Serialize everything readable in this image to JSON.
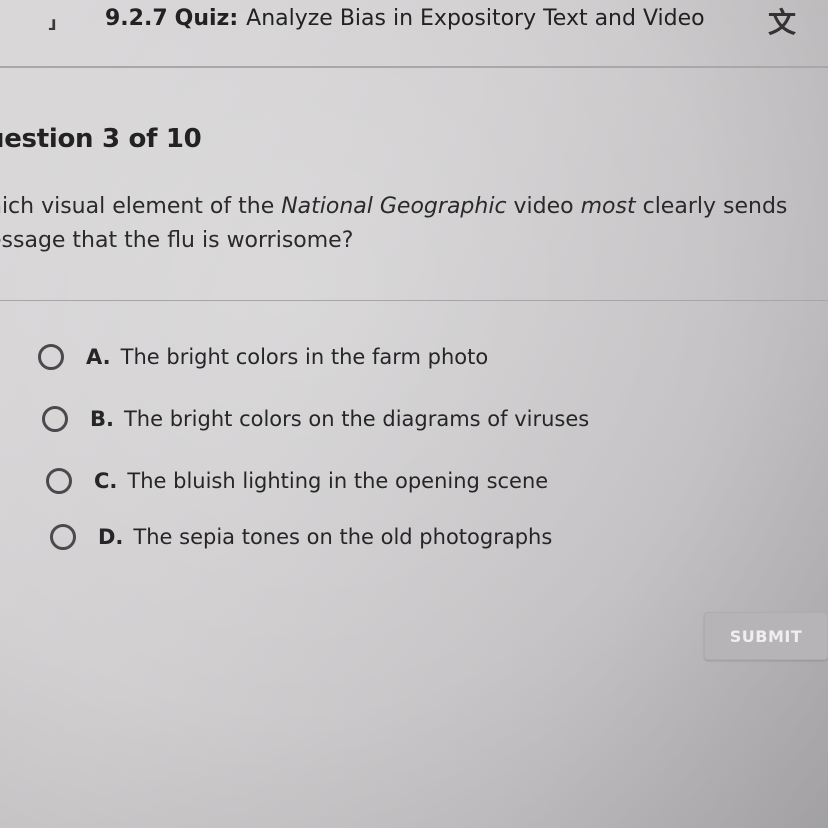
{
  "header": {
    "back_icon": "back-arrow-icon",
    "quiz_number": "9.2.7",
    "quiz_kind": "Quiz:",
    "quiz_title": "Analyze Bias in Expository Text and Video",
    "translate_icon": "translate-icon"
  },
  "question": {
    "header": "uestion 3 of 10",
    "text_part1": "hich visual element of the ",
    "text_italic1": "National Geographic",
    "text_part2": " video ",
    "text_italic2": "most",
    "text_part3": " clearly sends",
    "text_line2": "essage that the flu is worrisome?"
  },
  "answers": [
    {
      "letter": "A.",
      "text": "The bright colors in the farm photo"
    },
    {
      "letter": "B.",
      "text": "The bright colors on the diagrams of viruses"
    },
    {
      "letter": "C.",
      "text": "The bluish lighting in the opening scene"
    },
    {
      "letter": "D.",
      "text": "The sepia tones on the old photographs"
    }
  ],
  "submit_label": "SUBMIT",
  "colors": {
    "background": "#d1cfd0",
    "text": "#2a2a2c",
    "submit_bg": "#b6b4b6",
    "submit_text": "#efeff0"
  }
}
